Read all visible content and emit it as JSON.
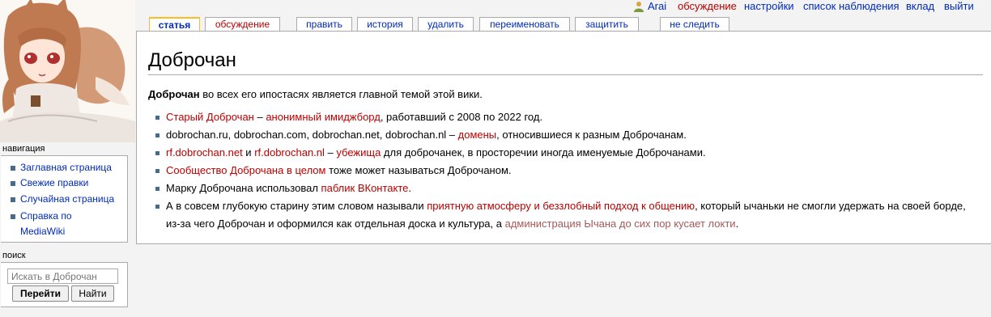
{
  "personal_tools": {
    "username": "Arai",
    "talk": "обсуждение",
    "preferences": "настройки",
    "watchlist": "список наблюдения",
    "contributions": "вклад",
    "logout": "выйти"
  },
  "tabs": {
    "article": "статья",
    "discussion": "обсуждение",
    "edit": "править",
    "history": "история",
    "delete": "удалить",
    "move": "переименовать",
    "protect": "защитить",
    "unwatch": "не следить"
  },
  "page": {
    "title": "Доброчан",
    "intro_bold": "Доброчан",
    "intro_rest": " во всех его ипостасях является главной темой этой вики.",
    "items": [
      {
        "a": "Старый Доброчан",
        "b": " – ",
        "c": "анонимный имиджборд",
        "d": ", работавший с 2008 по 2022 год."
      },
      {
        "a": "dobrochan.ru, dobrochan.com, dobrochan.net, dobrochan.nl – ",
        "b": "домены",
        "c": ", относившиеся к разным Доброчанам."
      },
      {
        "a": "rf.dobrochan.net",
        "b": " и ",
        "c": "rf.dobrochan.nl",
        "d": " – ",
        "e": "убежища",
        "f": " для доброчанек, в просторечии иногда именуемые Доброчанами."
      },
      {
        "a": "Сообщество Доброчана в целом",
        "b": " тоже может называться Доброчаном."
      },
      {
        "a": "Марку Доброчана использовал ",
        "b": "паблик ВКонтакте",
        "c": "."
      },
      {
        "a": "А в совсем глубокую старину этим словом называли ",
        "b": "приятную атмосферу и беззлобный подход к общению",
        "c": ", который ычаньки не смогли удержать на своей борде, из-за чего Доброчан и оформился как отдельная доска и культура, а ",
        "d": "администрация Ычана до сих пор кусает локти",
        "e": "."
      }
    ]
  },
  "navigation": {
    "heading": "навигация",
    "items": [
      "Заглавная страница",
      "Свежие правки",
      "Случайная страница",
      "Справка по",
      "MediaWiki"
    ]
  },
  "search": {
    "heading": "поиск",
    "placeholder": "Искать в Доброчан",
    "go": "Перейти",
    "find": "Найти"
  },
  "icons": {
    "user": "user-icon",
    "bullet": "square-bullet"
  },
  "colors": {
    "link": "#002bb8",
    "new_link": "#ba0000",
    "visited_new": "#a55858",
    "active_tab_border": "#fabd23",
    "background": "#f3f3f3"
  }
}
